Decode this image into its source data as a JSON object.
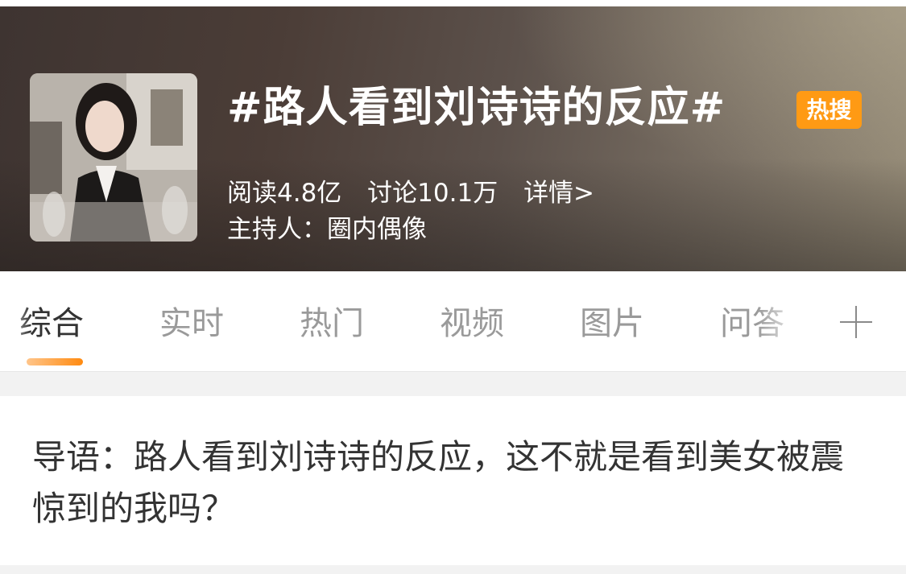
{
  "topic": {
    "title": "#路人看到刘诗诗的反应#",
    "badge": "热搜",
    "stats": {
      "reads": "阅读4.8亿",
      "discussions": "讨论10.1万",
      "details": "详情>"
    },
    "host": "主持人：圈内偶像"
  },
  "tabs": [
    {
      "label": "综合",
      "active": true
    },
    {
      "label": "实时",
      "active": false
    },
    {
      "label": "热门",
      "active": false
    },
    {
      "label": "视频",
      "active": false
    },
    {
      "label": "图片",
      "active": false
    },
    {
      "label": "问答",
      "active": false
    }
  ],
  "tab_add_icon": "plus-icon",
  "intro": {
    "text": "导语：路人看到刘诗诗的反应，这不就是看到美女被震惊到的我吗？"
  },
  "colors": {
    "badge": "#ff9a14",
    "tab_active": "#333333",
    "tab_inactive": "#9a9a9a",
    "underline": "#ff8a10"
  }
}
